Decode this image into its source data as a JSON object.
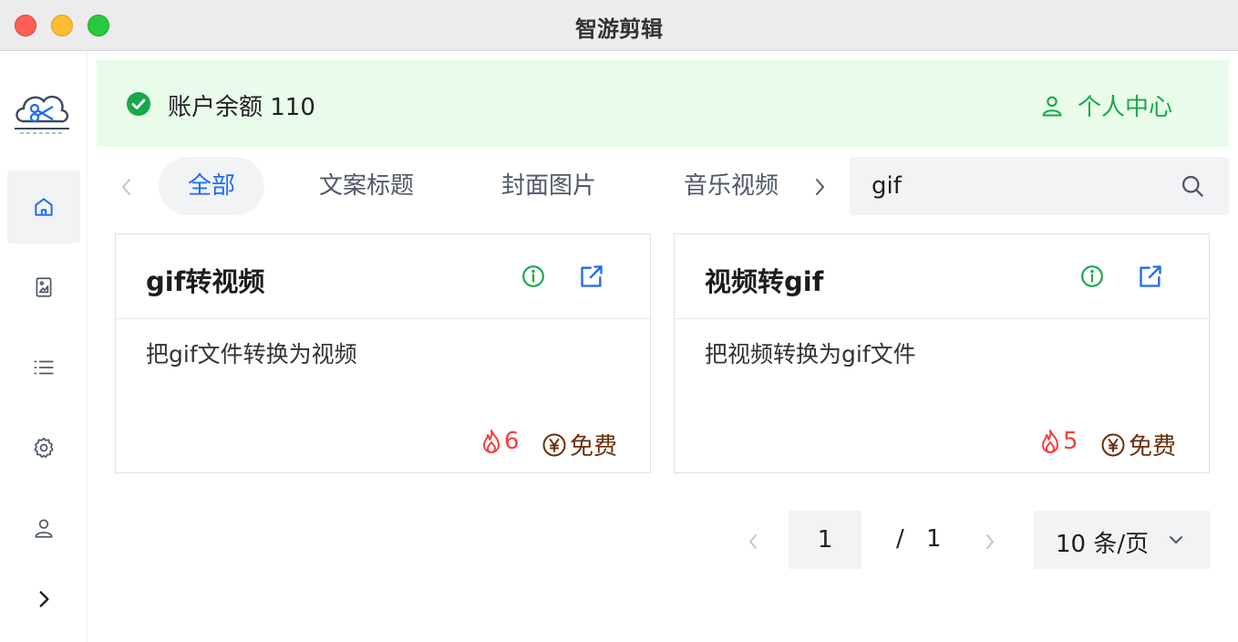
{
  "window": {
    "title": "智游剪辑"
  },
  "sidebar": {
    "items": [
      {
        "icon": "home-icon",
        "active": true
      },
      {
        "icon": "image-icon",
        "active": false
      },
      {
        "icon": "list-icon",
        "active": false
      },
      {
        "icon": "gear-icon",
        "active": false
      },
      {
        "icon": "user-icon",
        "active": false
      },
      {
        "icon": "chevron-right-icon",
        "active": false
      }
    ]
  },
  "banner": {
    "balance_label": "账户余额 110",
    "profile_label": "个人中心"
  },
  "tabs": [
    {
      "label": "全部",
      "active": true
    },
    {
      "label": "文案标题",
      "active": false
    },
    {
      "label": "封面图片",
      "active": false
    },
    {
      "label": "音乐视频",
      "active": false
    }
  ],
  "search": {
    "value": "gif"
  },
  "cards": [
    {
      "title": "gif转视频",
      "description": "把gif文件转换为视频",
      "hot_count": "6",
      "price": "免费"
    },
    {
      "title": "视频转gif",
      "description": "把视频转换为gif文件",
      "hot_count": "5",
      "price": "免费"
    }
  ],
  "pagination": {
    "current": "1",
    "separator": "/",
    "total": "1",
    "page_size": "10 条/页"
  },
  "colors": {
    "accent": "#1d6af1",
    "success": "#18a84a",
    "banner_bg": "#e8fce9",
    "hot": "#f53f3f",
    "price": "#6b2f0c"
  }
}
